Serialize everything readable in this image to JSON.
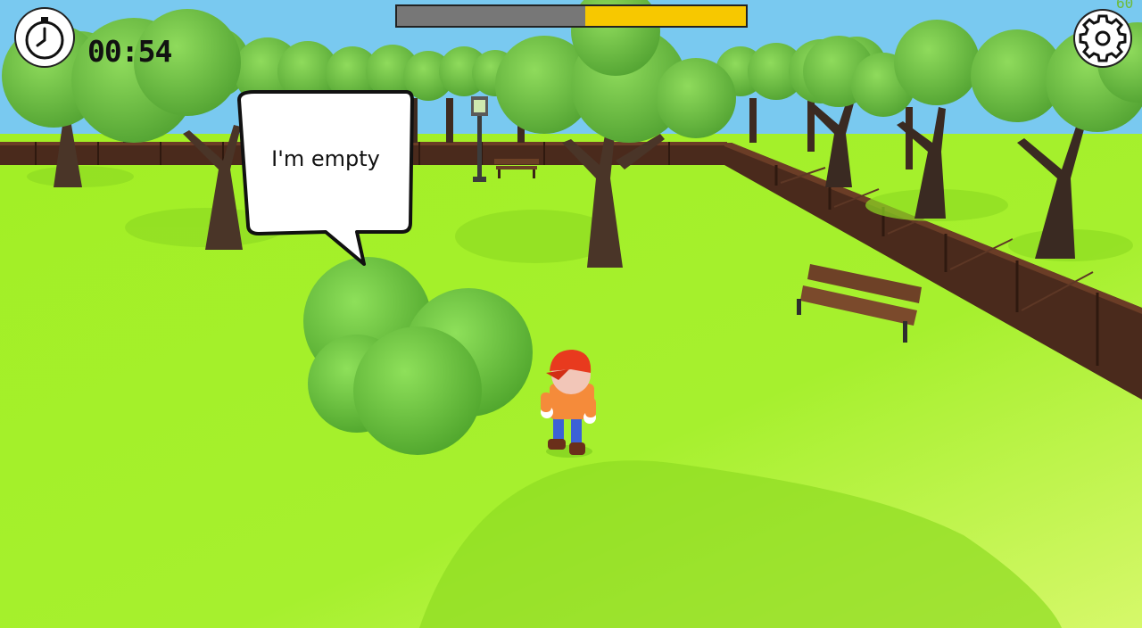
{
  "hud": {
    "timer": "00:54",
    "progress_fraction": 0.46,
    "progress_colors": {
      "empty": "#777777",
      "fill": "#f7c800"
    },
    "fps": "60",
    "timer_icon": "stopwatch-icon",
    "settings_icon": "gear-icon"
  },
  "speech_bubble": {
    "text": "I'm empty"
  },
  "colors": {
    "grass": "#a6f02e",
    "sky": "#79c9f0",
    "tree_foliage": "#6ccb3a",
    "fence": "#4a2a1c",
    "player_cap": "#e83a1e",
    "player_shirt": "#f58b3a",
    "player_pants": "#3c62d6"
  }
}
